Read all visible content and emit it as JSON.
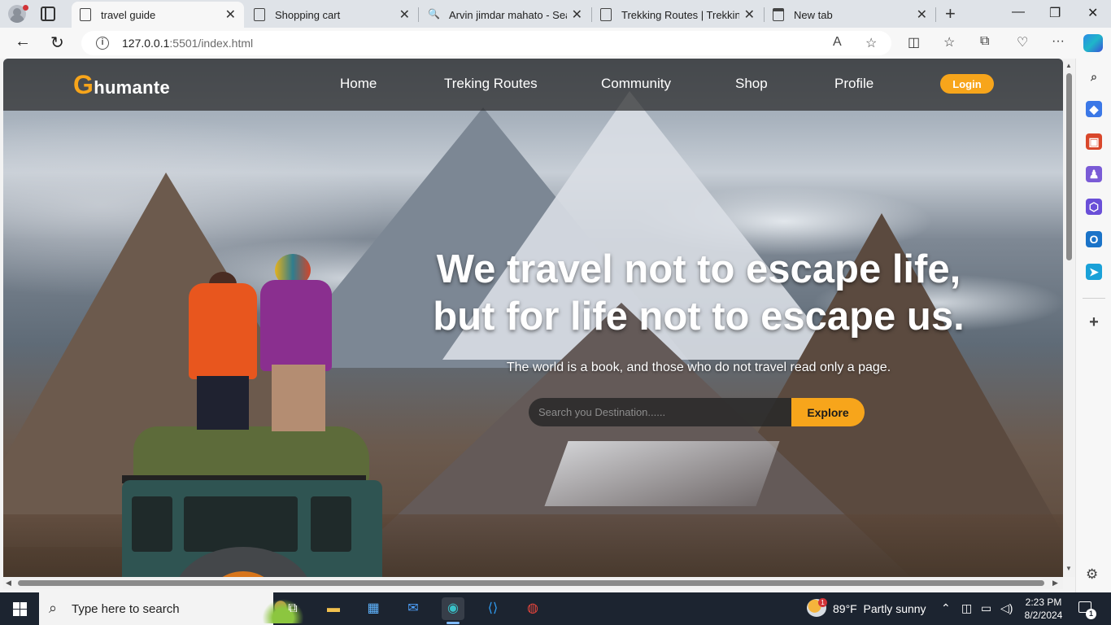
{
  "browser": {
    "tabs": [
      {
        "title": "travel guide",
        "icon": "page-icon",
        "active": true
      },
      {
        "title": "Shopping cart",
        "icon": "page-icon",
        "active": false
      },
      {
        "title": "Arvin jimdar mahato - Search",
        "icon": "search-icon",
        "active": false
      },
      {
        "title": "Trekking Routes | Trekking Guide",
        "icon": "page-icon",
        "active": false
      },
      {
        "title": "New tab",
        "icon": "new-tab-icon",
        "active": false
      }
    ],
    "url_host": "127.0.0.1",
    "url_path": ":5501/index.html"
  },
  "site": {
    "logo_initial": "G",
    "logo_rest": "humante",
    "nav": [
      "Home",
      "Treking Routes",
      "Community",
      "Shop",
      "Profile"
    ],
    "login_label": "Login",
    "hero_line1": "We travel not to escape life,",
    "hero_line2": "but for life not to escape us.",
    "hero_subtitle": "The world is a book, and those who do not travel read only a page.",
    "search_placeholder": "Search you Destination......",
    "explore_label": "Explore",
    "accent_color": "#f7a51b"
  },
  "taskbar": {
    "search_placeholder": "Type here to search",
    "weather_temp": "89°F",
    "weather_desc": "Partly sunny",
    "weather_alerts": "1",
    "time": "2:23 PM",
    "date": "8/2/2024",
    "notifications": "1"
  }
}
